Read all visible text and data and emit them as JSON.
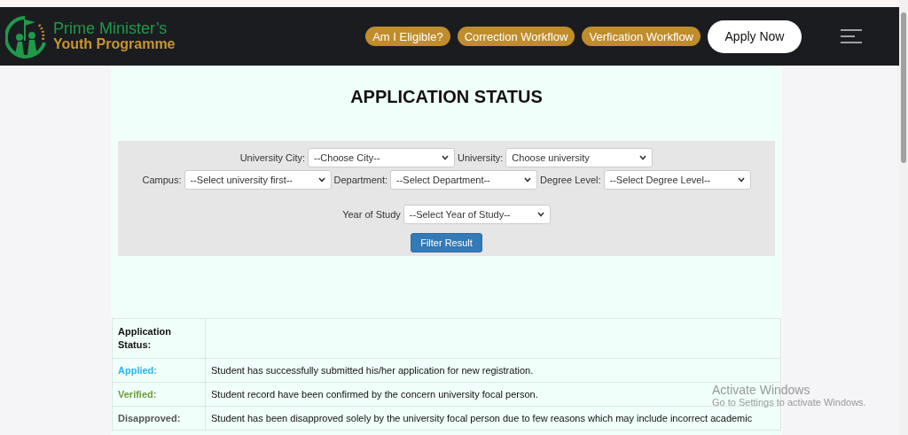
{
  "header": {
    "logo": {
      "line_1": "Prime Minister’s",
      "line_2": "Youth Programme"
    },
    "nav_buttons": [
      "Am I Eligible?",
      "Correction Workflow",
      "Verfication Workflow"
    ],
    "apply_button": "Apply Now"
  },
  "page_title": "APPLICATION STATUS",
  "filters": {
    "rows": [
      [
        {
          "label": "University City:",
          "placeholder": "--Choose City--"
        },
        {
          "label": "University:",
          "placeholder": "Choose university"
        }
      ],
      [
        {
          "label": "Campus:",
          "placeholder": "--Select university first--"
        },
        {
          "label": "Department:",
          "placeholder": "--Select Department--"
        },
        {
          "label": "Degree Level:",
          "placeholder": "--Select Degree Level--"
        }
      ],
      [
        {
          "label": "Year of Study",
          "placeholder": "--Select Year of Study--"
        }
      ]
    ],
    "button": "Filter Result"
  },
  "status_table": {
    "heading": "Application Status:",
    "rows": [
      {
        "status": "Applied:",
        "color": "#29b6e8",
        "description": "Student has successfully submitted his/her application for new registration."
      },
      {
        "status": "Verified:",
        "color": "#6f9a3c",
        "description": "Student record have been confirmed by the concern university focal person."
      },
      {
        "status": "Disapproved:",
        "color": "#555555",
        "description": "Student has been disapproved solely by the university focal person due to few reasons which may include incorrect academic"
      }
    ]
  },
  "os_notice": {
    "title": "Activate Windows",
    "subtitle": "Go to Settings to activate Windows."
  }
}
